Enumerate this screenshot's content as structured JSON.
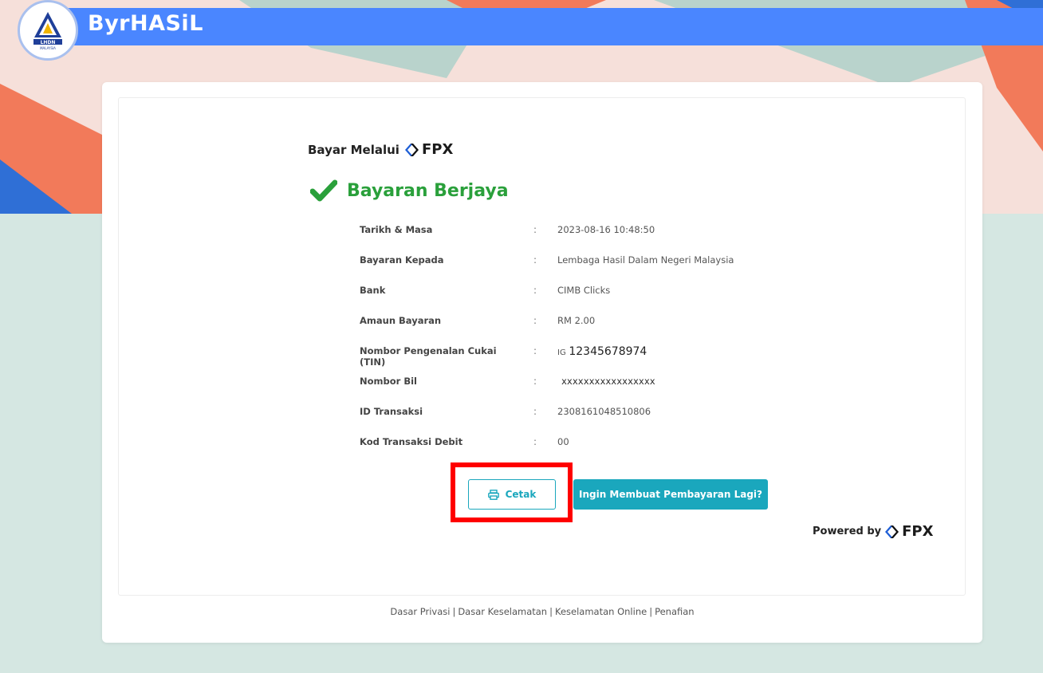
{
  "header": {
    "app_title": "ByrHASiL",
    "logo_text": "LHDN",
    "logo_subtext": "MALAYSIA"
  },
  "payment": {
    "pay_via": "Bayar Melalui",
    "fpx_label": "FPX",
    "status_title": "Bayaran Berjaya",
    "separator": ":",
    "rows": [
      {
        "label": "Tarikh & Masa",
        "value": "2023-08-16 10:48:50"
      },
      {
        "label": "Bayaran Kepada",
        "value": "Lembaga Hasil Dalam Negeri Malaysia"
      },
      {
        "label": "Bank",
        "value": "CIMB Clicks"
      },
      {
        "label": "Amaun Bayaran",
        "value": "RM 2.00"
      },
      {
        "label": "Nombor Pengenalan Cukai (TIN)",
        "value_prefix": "IG",
        "value": "12345678974"
      },
      {
        "label": "Nombor Bil",
        "value": "xxxxxxxxxxxxxxxxx"
      },
      {
        "label": "ID Transaksi",
        "value": "2308161048510806"
      },
      {
        "label": "Kod Transaksi Debit",
        "value": "00"
      }
    ]
  },
  "actions": {
    "print_label": "Cetak",
    "again_label": "Ingin Membuat Pembayaran Lagi?"
  },
  "powered": {
    "text": "Powered by",
    "fpx_label": "FPX"
  },
  "footer": {
    "links": [
      "Dasar Privasi",
      "Dasar Keselamatan",
      "Keselamatan Online",
      "Penafian"
    ],
    "separator": "|"
  },
  "colors": {
    "header_blue": "#4a86ff",
    "success_green": "#2aa03b",
    "button_teal": "#1aa7bd",
    "highlight_red": "#ff0000",
    "background": "#d5e7e2"
  }
}
